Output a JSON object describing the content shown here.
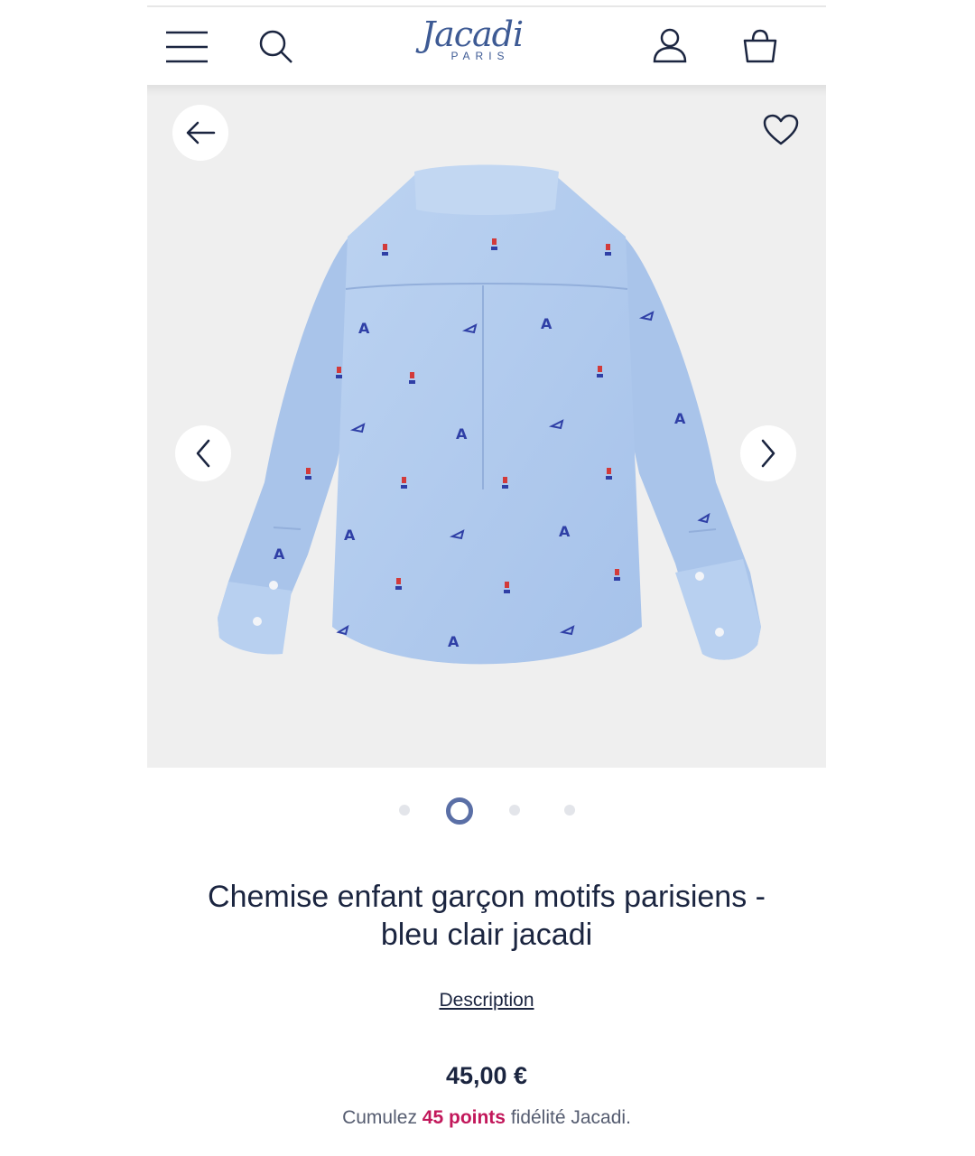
{
  "header": {
    "brand": "Jacadi",
    "brand_sub": "PARIS",
    "icons": {
      "menu": "hamburger-menu-icon",
      "search": "search-icon",
      "account": "user-icon",
      "bag": "shopping-bag-icon"
    }
  },
  "gallery": {
    "icons": {
      "back": "arrow-left-icon",
      "favorite": "heart-icon",
      "prev": "chevron-left-icon",
      "next": "chevron-right-icon"
    },
    "slide_count": 4,
    "active_slide": 2,
    "background": "#efefef",
    "shirt_color": "#b3cdee"
  },
  "product": {
    "title_line1": "Chemise enfant garçon motifs parisiens -",
    "title_line2": "bleu clair jacadi",
    "description_link": "Description",
    "price": "45,00 €",
    "loyalty_prefix": "Cumulez",
    "loyalty_points": "45 points",
    "loyalty_suffix": "fidélité Jacadi."
  },
  "colors": {
    "brand_blue": "#3d5a94",
    "text_dark": "#1b2540",
    "points_accent": "#c2185b",
    "dot_active": "#5a6fa6"
  }
}
